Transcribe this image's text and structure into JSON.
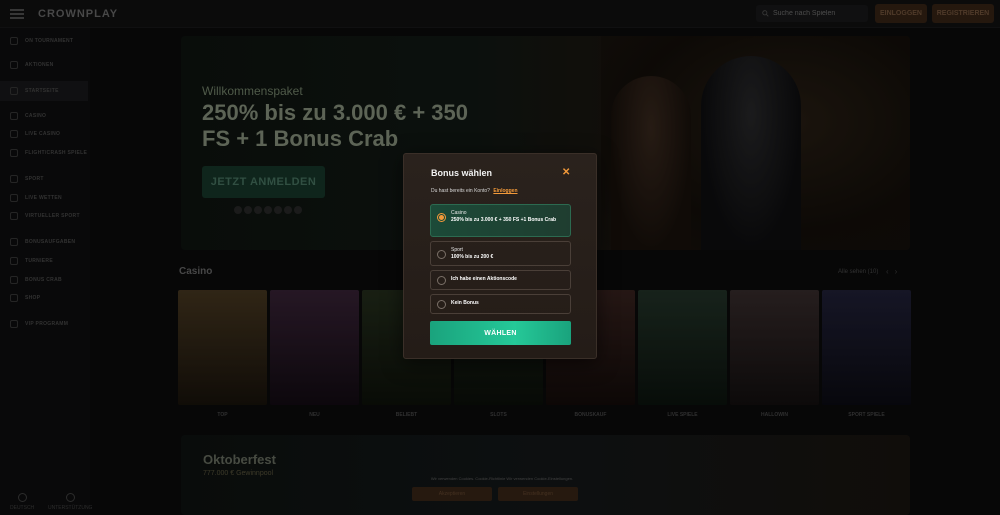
{
  "topbar": {
    "logo": "CROWNPLAY",
    "search_placeholder": "Suche nach Spielen",
    "login_label": "EINLOGGEN",
    "register_label": "REGISTRIEREN"
  },
  "sidebar": {
    "items": [
      {
        "label": "ON TOURNAMENT",
        "icon": "trophy-icon"
      },
      {
        "label": "AKTIONEN",
        "icon": "gift-icon"
      },
      {
        "label": "STARTSEITE",
        "icon": "home-icon"
      },
      {
        "label": "CASINO",
        "icon": "cards-icon"
      },
      {
        "label": "LIVE CASINO",
        "icon": "live-icon"
      },
      {
        "label": "FLIGHT/CRASH SPIELE",
        "icon": "rocket-icon"
      },
      {
        "label": "SPORT",
        "icon": "ball-icon"
      },
      {
        "label": "LIVE WETTEN",
        "icon": "live-bet-icon"
      },
      {
        "label": "VIRTUELLER SPORT",
        "icon": "virtual-icon"
      },
      {
        "label": "BONUSAUFGABEN",
        "icon": "task-icon"
      },
      {
        "label": "TURNIERE",
        "icon": "cup-icon"
      },
      {
        "label": "BONUS CRAB",
        "icon": "crab-icon"
      },
      {
        "label": "SHOP",
        "icon": "shop-icon"
      },
      {
        "label": "VIP PROGRAMM",
        "icon": "crown-icon"
      }
    ],
    "bottom_left": "DEUTSCH",
    "bottom_right": "UNTERSTÜTZUNG"
  },
  "hero": {
    "subtitle": "Willkommenspaket",
    "title": "250% bis zu 3.000 € + 350 FS + 1 Bonus Crab",
    "cta": "JETZT ANMELDEN"
  },
  "casino": {
    "title": "Casino",
    "see_all": "Alle sehen (10)",
    "games": [
      {
        "name": "TOP",
        "color": "#3a3020"
      },
      {
        "name": "NEU",
        "color": "#2a1f2a"
      },
      {
        "name": "BELIEBT",
        "color": "#1c2418"
      },
      {
        "name": "SLOTS",
        "color": "#1a2018"
      },
      {
        "name": "BONUSKAUF",
        "color": "#2a1a18"
      },
      {
        "name": "LIVE SPIELE",
        "color": "#1e2a22"
      },
      {
        "name": "HALLOWIN",
        "color": "#2a2424"
      },
      {
        "name": "SPORT SPIELE",
        "color": "#1a1a24"
      }
    ]
  },
  "oktoberfest": {
    "title": "Oktoberfest",
    "subtitle": "777.000 € Gewinnpool"
  },
  "cookie": {
    "text": "Wir verwenden Cookies. Cookie-Richtlinie Wir verwenden Cookie-Einstellungen.",
    "accept": "Akzeptieren",
    "settings": "Einstellungen"
  },
  "modal": {
    "title": "Bonus wählen",
    "login_prompt": "Du hast bereits ein Konto?",
    "login_link": "Einloggen",
    "options": [
      {
        "category": "Casino",
        "description": "250% bis zu 3.000 € + 350 FS +1 Bonus Crab",
        "selected": true
      },
      {
        "category": "Sport",
        "description": "100% bis zu 200 €",
        "selected": false
      },
      {
        "category": "",
        "description": "Ich habe einen Aktionscode",
        "selected": false
      },
      {
        "category": "",
        "description": "Kein Bonus",
        "selected": false
      }
    ],
    "choose_button": "WÄHLEN",
    "accent": "#f39a3a",
    "button_color": "#25c898"
  }
}
